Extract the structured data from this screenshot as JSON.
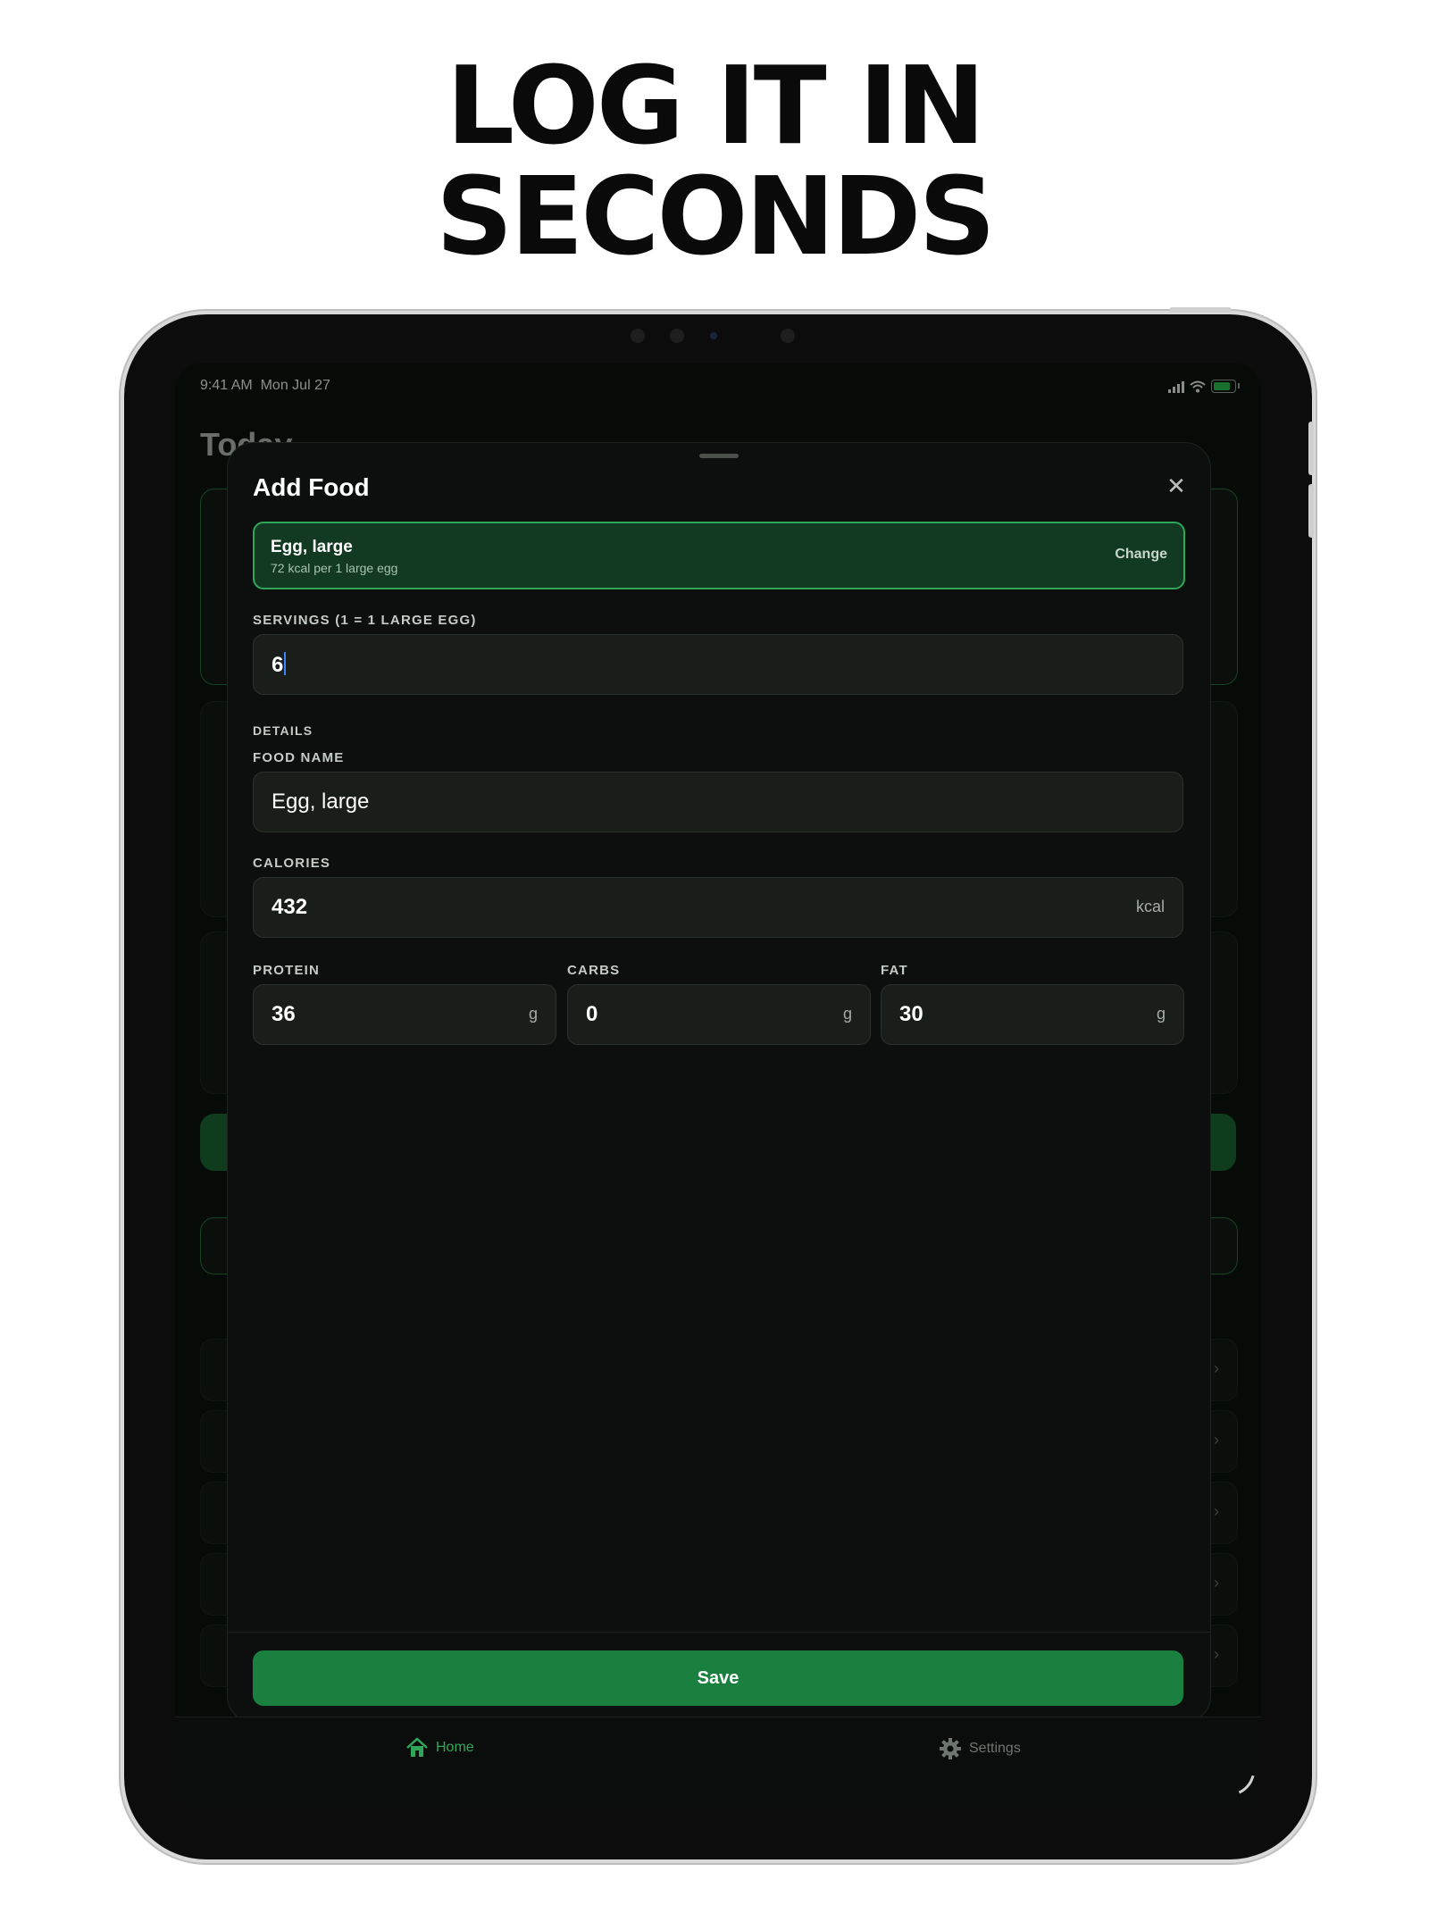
{
  "headline": {
    "line1": "LOG IT IN",
    "line2": "SECONDS"
  },
  "status_bar": {
    "time": "9:41 AM",
    "date": "Mon Jul 27"
  },
  "background": {
    "title": "Today"
  },
  "modal": {
    "title": "Add Food",
    "close_icon": "close-icon",
    "selected_food": {
      "name": "Egg, large",
      "detail": "72 kcal per 1 large egg",
      "change_label": "Change"
    },
    "servings": {
      "label": "SERVINGS (1 = 1 LARGE EGG)",
      "value": "6"
    },
    "details_label": "DETAILS",
    "food_name": {
      "label": "FOOD NAME",
      "value": "Egg, large"
    },
    "calories": {
      "label": "CALORIES",
      "value": "432",
      "unit": "kcal"
    },
    "protein": {
      "label": "PROTEIN",
      "value": "36",
      "unit": "g"
    },
    "carbs": {
      "label": "CARBS",
      "value": "0",
      "unit": "g"
    },
    "fat": {
      "label": "FAT",
      "value": "30",
      "unit": "g"
    },
    "save_label": "Save"
  },
  "tab_bar": {
    "home": {
      "label": "Home",
      "icon": "house-icon"
    },
    "settings": {
      "label": "Settings",
      "icon": "gear-icon"
    }
  },
  "colors": {
    "accent": "#1a8040",
    "accent_border": "#2ea858",
    "sheet_bg": "#0c0f0d",
    "field_bg": "#1a1e1b"
  }
}
